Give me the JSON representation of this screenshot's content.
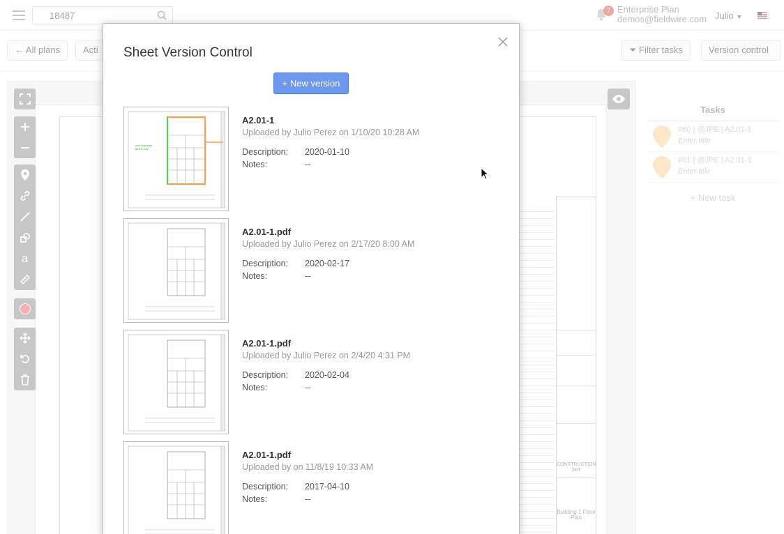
{
  "topbar": {
    "search_value": "18487",
    "notification_count": "7",
    "plan_name": "Enterprise Plan",
    "email": "demos@fieldwire.com",
    "user_name": "Julio"
  },
  "subbar": {
    "all_plans": "All plans",
    "actions": "Acti",
    "filter_tasks": "Filter tasks",
    "version_control": "Version control"
  },
  "titleblock": {
    "set_label": "CONSTRUCTION SET",
    "sheet_title": "Building 1 Floor Plan"
  },
  "tasks": {
    "title": "Tasks",
    "items": [
      {
        "meta": "#60 | @JPE | A2.01-1",
        "title": "Enter title"
      },
      {
        "meta": "#61 | @JPE | A2.01-1",
        "title": "Enter title"
      }
    ],
    "new_task": "+ New task",
    "pin_color": "#f9d39b"
  },
  "modal": {
    "title": "Sheet Version Control",
    "new_version_label": "+ New version",
    "description_label": "Description:",
    "notes_label": "Notes:",
    "versions": [
      {
        "name": "A2.01-1",
        "uploaded": "Uploaded by Julio Perez on 1/10/20 10:28 AM",
        "description": "2020-01-10",
        "notes": "--"
      },
      {
        "name": "A2.01-1.pdf",
        "uploaded": "Uploaded by Julio Perez on 2/17/20 8:00 AM",
        "description": "2020-02-17",
        "notes": "--"
      },
      {
        "name": "A2.01-1.pdf",
        "uploaded": "Uploaded by Julio Perez on 2/4/20 4:31 PM",
        "description": "2020-02-04",
        "notes": "--"
      },
      {
        "name": "A2.01-1.pdf",
        "uploaded": "Uploaded by on 11/8/19 10:33 AM",
        "description": "2017-04-10",
        "notes": "--"
      }
    ],
    "accent_color": "#6d98ee"
  }
}
